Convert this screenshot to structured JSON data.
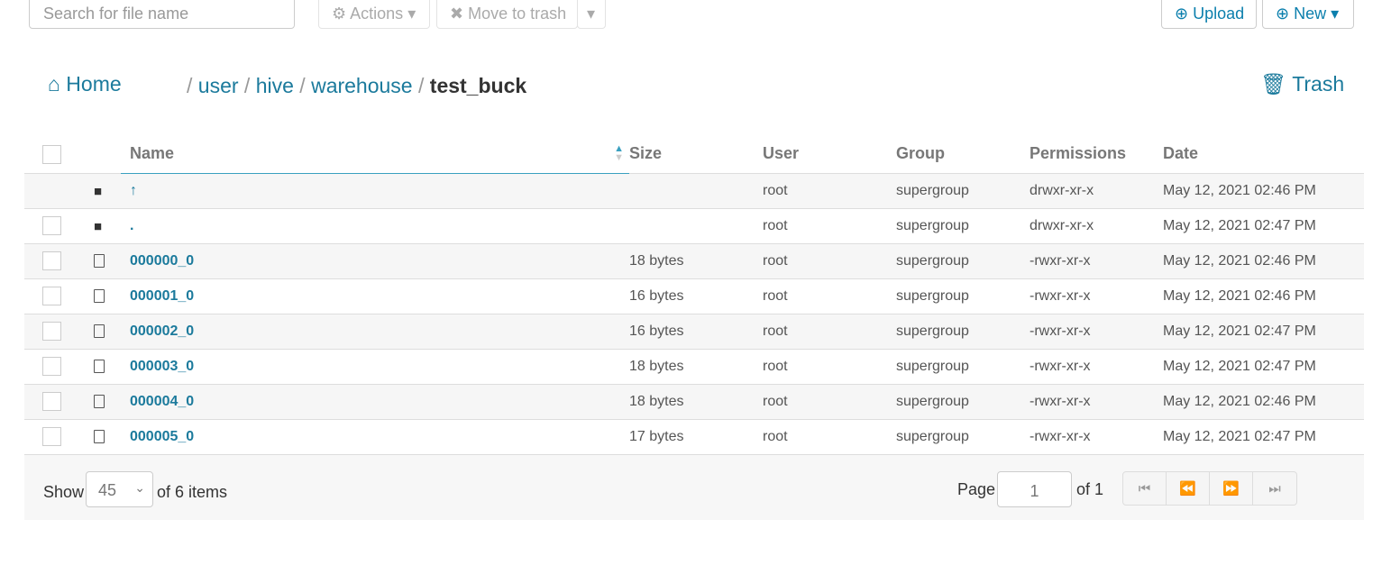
{
  "toolbar": {
    "search_placeholder": "Search for file name",
    "actions": "Actions",
    "move_to_trash": "Move to trash",
    "upload": "Upload",
    "new": "New"
  },
  "breadcrumb": {
    "home": "Home",
    "parts": [
      "user",
      "hive",
      "warehouse"
    ],
    "current": "test_buck",
    "trash": "Trash"
  },
  "table": {
    "headers": {
      "name": "Name",
      "size": "Size",
      "user": "User",
      "group": "Group",
      "permissions": "Permissions",
      "date": "Date"
    },
    "sort": {
      "column": "Name",
      "direction": "ascending"
    },
    "rows": [
      {
        "type": "folder",
        "name": "↑",
        "size": "",
        "user": "root",
        "group": "supergroup",
        "permissions": "drwxr-xr-x",
        "date": "May 12, 2021 02:46 PM"
      },
      {
        "type": "folder",
        "name": ".",
        "size": "",
        "user": "root",
        "group": "supergroup",
        "permissions": "drwxr-xr-x",
        "date": "May 12, 2021 02:47 PM"
      },
      {
        "type": "file",
        "name": "000000_0",
        "size": "18 bytes",
        "user": "root",
        "group": "supergroup",
        "permissions": "-rwxr-xr-x",
        "date": "May 12, 2021 02:46 PM"
      },
      {
        "type": "file",
        "name": "000001_0",
        "size": "16 bytes",
        "user": "root",
        "group": "supergroup",
        "permissions": "-rwxr-xr-x",
        "date": "May 12, 2021 02:46 PM"
      },
      {
        "type": "file",
        "name": "000002_0",
        "size": "16 bytes",
        "user": "root",
        "group": "supergroup",
        "permissions": "-rwxr-xr-x",
        "date": "May 12, 2021 02:47 PM"
      },
      {
        "type": "file",
        "name": "000003_0",
        "size": "18 bytes",
        "user": "root",
        "group": "supergroup",
        "permissions": "-rwxr-xr-x",
        "date": "May 12, 2021 02:47 PM"
      },
      {
        "type": "file",
        "name": "000004_0",
        "size": "18 bytes",
        "user": "root",
        "group": "supergroup",
        "permissions": "-rwxr-xr-x",
        "date": "May 12, 2021 02:46 PM"
      },
      {
        "type": "file",
        "name": "000005_0",
        "size": "17 bytes",
        "user": "root",
        "group": "supergroup",
        "permissions": "-rwxr-xr-x",
        "date": "May 12, 2021 02:47 PM"
      }
    ]
  },
  "footer": {
    "show": "Show",
    "page_size": "45",
    "of_items": "of 6 items",
    "page": "Page",
    "page_value": "1",
    "of_pages": "of 1"
  },
  "colors": {
    "accent": "#1b7a9c"
  }
}
